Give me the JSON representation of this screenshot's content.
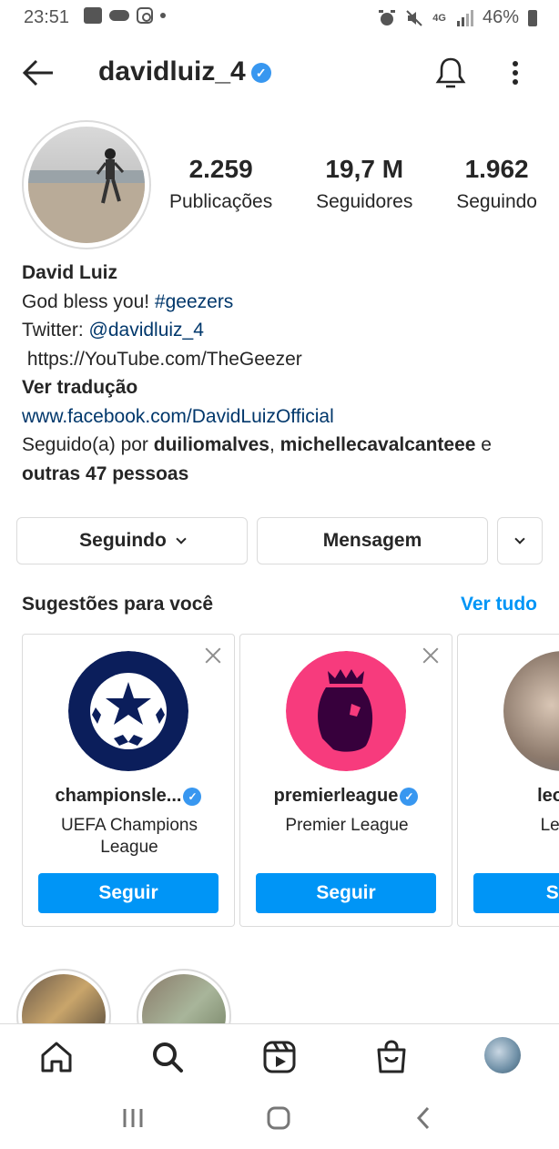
{
  "status_bar": {
    "time": "23:51",
    "network": "4G",
    "battery": "46%"
  },
  "header": {
    "username": "davidluiz_4",
    "verified_icon": "verified-badge-icon"
  },
  "profile": {
    "stats": [
      {
        "value": "2.259",
        "label": "Publicações"
      },
      {
        "value": "19,7 M",
        "label": "Seguidores"
      },
      {
        "value": "1.962",
        "label": "Seguindo"
      }
    ],
    "bio": {
      "name": "David Luiz",
      "line1_text": "God bless you! ",
      "line1_hashtag": "#geezers",
      "line2_text": "Twitter: ",
      "line2_mention": "@davidluiz_4",
      "line3": " https://YouTube.com/TheGeezer",
      "translate": "Ver tradução",
      "website": "www.facebook.com/DavidLuizOfficial",
      "followed_prefix": "Seguido(a) por ",
      "followed_user1": "duiliomalves",
      "followed_sep": ", ",
      "followed_user2": "michellecavalcanteee",
      "followed_and": " e",
      "followed_others": "outras 47 pessoas"
    }
  },
  "actions": {
    "following": "Seguindo",
    "message": "Mensagem"
  },
  "suggestions": {
    "title": "Sugestões para você",
    "see_all": "Ver tudo",
    "cards": [
      {
        "name": "championsle...",
        "subtitle": "UEFA Champions League",
        "button": "Seguir"
      },
      {
        "name": "premierleague",
        "subtitle": "Premier League",
        "button": "Seguir"
      },
      {
        "name": "leome",
        "subtitle": "Leo M",
        "button": "Seg"
      }
    ]
  },
  "colors": {
    "accent": "#0095f6",
    "link": "#00376b",
    "ucl_navy": "#0b1e5b",
    "pl_pink": "#f73b7d",
    "pl_purple": "#37003c"
  }
}
